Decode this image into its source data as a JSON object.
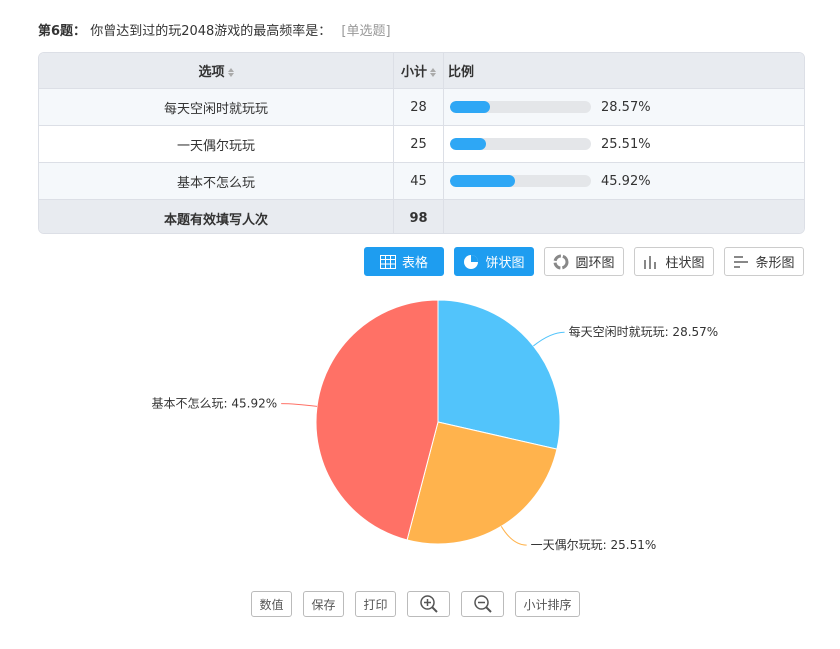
{
  "question": {
    "number": "第6题：",
    "text": "你曾达到过的玩2048游戏的最高频率是：",
    "type": "[单选题]"
  },
  "table": {
    "headers": {
      "option": "选项",
      "count": "小计",
      "ratio": "比例"
    },
    "rows": [
      {
        "option": "每天空闲时就玩玩",
        "count": "28",
        "pct_label": "28.57%",
        "pct": 28.57
      },
      {
        "option": "一天偶尔玩玩",
        "count": "25",
        "pct_label": "25.51%",
        "pct": 25.51
      },
      {
        "option": "基本不怎么玩",
        "count": "45",
        "pct_label": "45.92%",
        "pct": 45.92
      }
    ],
    "total": {
      "label": "本题有效填写人次",
      "count": "98"
    }
  },
  "view_buttons": {
    "table": "表格",
    "pie": "饼状图",
    "donut": "圆环图",
    "column": "柱状图",
    "bar": "条形图"
  },
  "tools": {
    "value": "数值",
    "save": "保存",
    "print": "打印",
    "sort": "小计排序"
  },
  "colors": {
    "accent": "#1e9df0",
    "bar_fill": "#2ea7f5"
  },
  "chart_data": {
    "type": "pie",
    "slices": [
      {
        "label": "每天空闲时就玩玩: 28.57%",
        "value": 28.57,
        "color": "#52c4fb"
      },
      {
        "label": "一天偶尔玩玩: 25.51%",
        "value": 25.51,
        "color": "#ffb34d"
      },
      {
        "label": "基本不怎么玩: 45.92%",
        "value": 45.92,
        "color": "#ff7166"
      }
    ]
  }
}
